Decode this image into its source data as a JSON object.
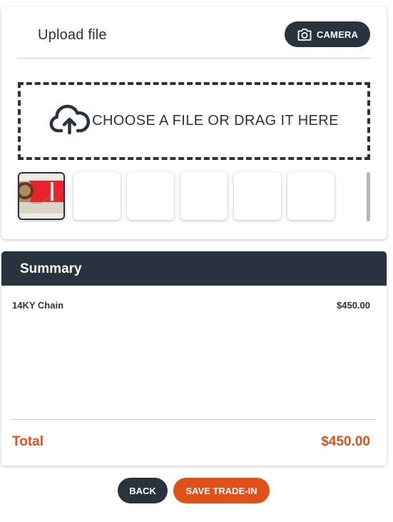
{
  "upload": {
    "title": "Upload file",
    "camera_label": "CAMERA",
    "dropzone_text": "CHOOSE A FILE OR DRAG IT HERE",
    "thumbnails": [
      {
        "state": "filled",
        "icon": "chain-photo"
      },
      {
        "state": "empty"
      },
      {
        "state": "empty"
      },
      {
        "state": "empty"
      },
      {
        "state": "empty"
      },
      {
        "state": "empty"
      }
    ]
  },
  "summary": {
    "title": "Summary",
    "items": [
      {
        "name": "14KY Chain",
        "price": "$450.00"
      }
    ],
    "total_label": "Total",
    "total_value": "$450.00"
  },
  "actions": {
    "back_label": "BACK",
    "save_label": "SAVE TRADE-IN"
  },
  "colors": {
    "primary": "#29333f",
    "accent": "#e0501a"
  },
  "icons": {
    "camera": "camera-icon",
    "upload": "cloud-upload-icon"
  }
}
